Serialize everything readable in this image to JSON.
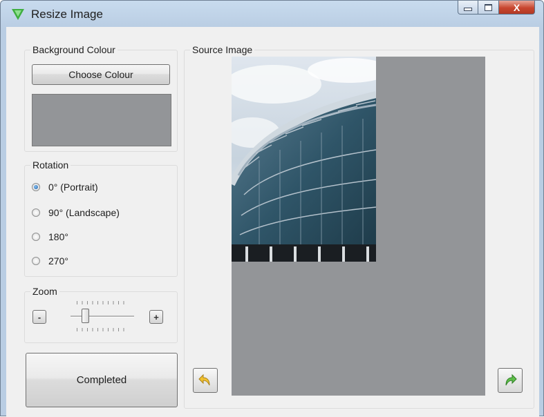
{
  "window": {
    "title": "Resize Image",
    "close_glyph": "X"
  },
  "background_colour": {
    "group_label": "Background Colour",
    "choose_button": "Choose Colour",
    "swatch_color": "#939598"
  },
  "rotation": {
    "group_label": "Rotation",
    "options": [
      "0° (Portrait)",
      "90° (Landscape)",
      "180°",
      "270°"
    ],
    "selected": "0° (Portrait)"
  },
  "zoom": {
    "group_label": "Zoom",
    "minus_label": "-",
    "plus_label": "+",
    "level_fraction": 0.2
  },
  "completed_button": "Completed",
  "source_image": {
    "group_label": "Source Image",
    "photo_subject": "stadium-arch-photo",
    "undo_icon": "rotate-left-arrow-icon",
    "redo_icon": "rotate-right-arrow-icon"
  }
}
